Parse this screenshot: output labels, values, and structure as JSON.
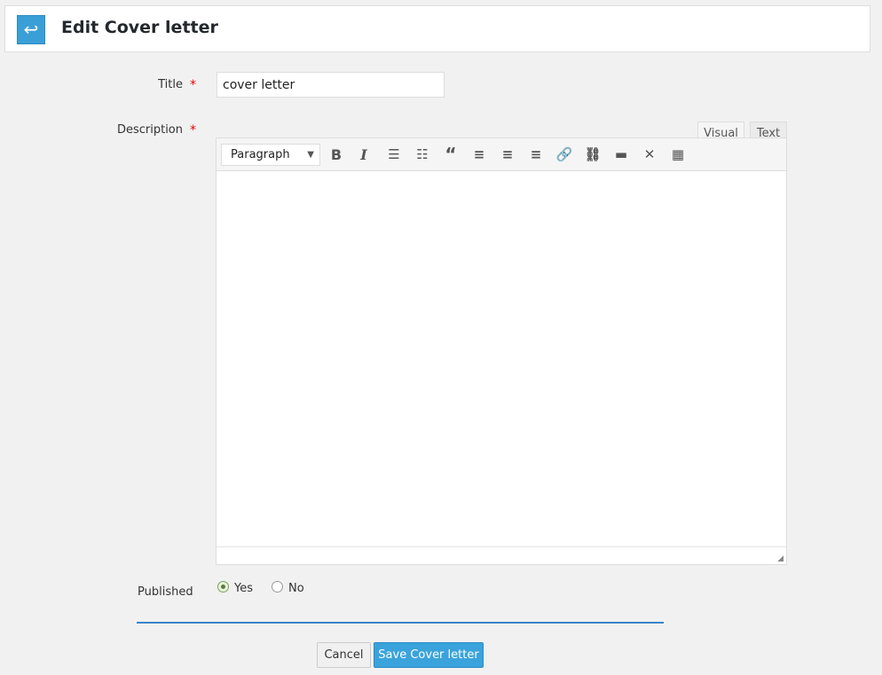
{
  "header": {
    "title": "Edit Cover letter",
    "back_icon": "arrow-back-icon"
  },
  "form": {
    "title_label": "Title",
    "required_mark": "*",
    "title_value": "cover letter",
    "description_label": "Description",
    "editor": {
      "tabs": [
        {
          "label": "Visual",
          "active": true
        },
        {
          "label": "Text",
          "active": false
        }
      ],
      "format_select": "Paragraph",
      "toolbar_icons": [
        "bold-icon",
        "italic-icon",
        "bullet-list-icon",
        "numbered-list-icon",
        "blockquote-icon",
        "align-left-icon",
        "align-center-icon",
        "align-right-icon",
        "link-icon",
        "unlink-icon",
        "read-more-icon",
        "fullscreen-icon",
        "toolbar-toggle-icon"
      ],
      "content": ""
    },
    "published_label": "Published",
    "published_options": [
      {
        "label": "Yes",
        "selected": true
      },
      {
        "label": "No",
        "selected": false
      }
    ]
  },
  "actions": {
    "cancel": "Cancel",
    "save": "Save Cover letter"
  },
  "colors": {
    "accent": "#3aa3dc",
    "required": "#ee0000"
  }
}
